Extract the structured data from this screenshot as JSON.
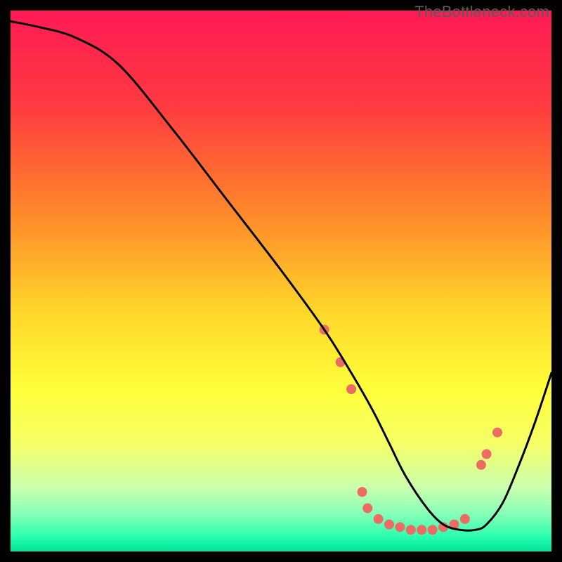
{
  "watermark": "TheBottleneck.com",
  "chart_data": {
    "type": "line",
    "title": "",
    "xlabel": "",
    "ylabel": "",
    "xlim": [
      0,
      100
    ],
    "ylim": [
      0,
      100
    ],
    "gradient_stops": [
      {
        "pos": 0.0,
        "color": "#ff1a55"
      },
      {
        "pos": 0.18,
        "color": "#ff3b3f"
      },
      {
        "pos": 0.38,
        "color": "#ff8a2a"
      },
      {
        "pos": 0.55,
        "color": "#ffd42a"
      },
      {
        "pos": 0.7,
        "color": "#ffff3a"
      },
      {
        "pos": 0.8,
        "color": "#f6ff66"
      },
      {
        "pos": 0.88,
        "color": "#ccffad"
      },
      {
        "pos": 0.93,
        "color": "#88ffb8"
      },
      {
        "pos": 0.97,
        "color": "#30ffb0"
      },
      {
        "pos": 1.0,
        "color": "#00e59a"
      }
    ],
    "series": [
      {
        "name": "bottleneck-curve",
        "x": [
          0,
          5,
          12,
          20,
          30,
          40,
          50,
          58,
          63,
          67,
          70,
          73,
          77,
          80,
          83,
          86,
          88,
          91,
          94,
          97,
          100
        ],
        "y": [
          98,
          97,
          95,
          90,
          78,
          65,
          52,
          41,
          33,
          26,
          20,
          14,
          8,
          5,
          4,
          4,
          5,
          9,
          16,
          24,
          33
        ]
      }
    ],
    "markers": {
      "name": "highlight-dots",
      "color": "#ec6b62",
      "radius": 7,
      "points": [
        {
          "x": 58,
          "y": 41
        },
        {
          "x": 61,
          "y": 35
        },
        {
          "x": 63,
          "y": 30
        },
        {
          "x": 65,
          "y": 11
        },
        {
          "x": 66,
          "y": 8
        },
        {
          "x": 68,
          "y": 6
        },
        {
          "x": 70,
          "y": 5
        },
        {
          "x": 72,
          "y": 4.5
        },
        {
          "x": 74,
          "y": 4
        },
        {
          "x": 76,
          "y": 4
        },
        {
          "x": 78,
          "y": 4
        },
        {
          "x": 80,
          "y": 4.5
        },
        {
          "x": 82,
          "y": 5
        },
        {
          "x": 84,
          "y": 6
        },
        {
          "x": 87,
          "y": 16
        },
        {
          "x": 88,
          "y": 18
        },
        {
          "x": 90,
          "y": 22
        }
      ]
    }
  }
}
